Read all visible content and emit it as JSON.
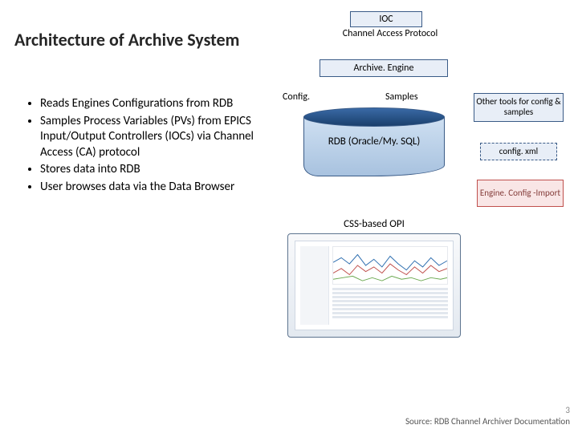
{
  "title": "Architecture of Archive System",
  "bullets": {
    "b0": "Reads Engines Configurations from RDB",
    "b1": "Samples Process Variables (PVs) from EPICS Input/Output Controllers (IOCs) via Channel Access (CA) protocol",
    "b2": "Stores data into RDB",
    "b3": "User browses data via the Data Browser"
  },
  "diagram": {
    "ioc": "IOC",
    "ca_protocol": "Channel Access Protocol",
    "engine": "Archive. Engine",
    "config_label": "Config.",
    "samples_label": "Samples",
    "db": "RDB (Oracle/My. SQL)",
    "other_tools": "Other tools for config & samples",
    "configxml": "config. xml",
    "import": "Engine. Config -Import",
    "opi": "CSS-based OPI"
  },
  "footer": {
    "page": "3",
    "source": "Source: RDB Channel Archiver Documentation"
  }
}
